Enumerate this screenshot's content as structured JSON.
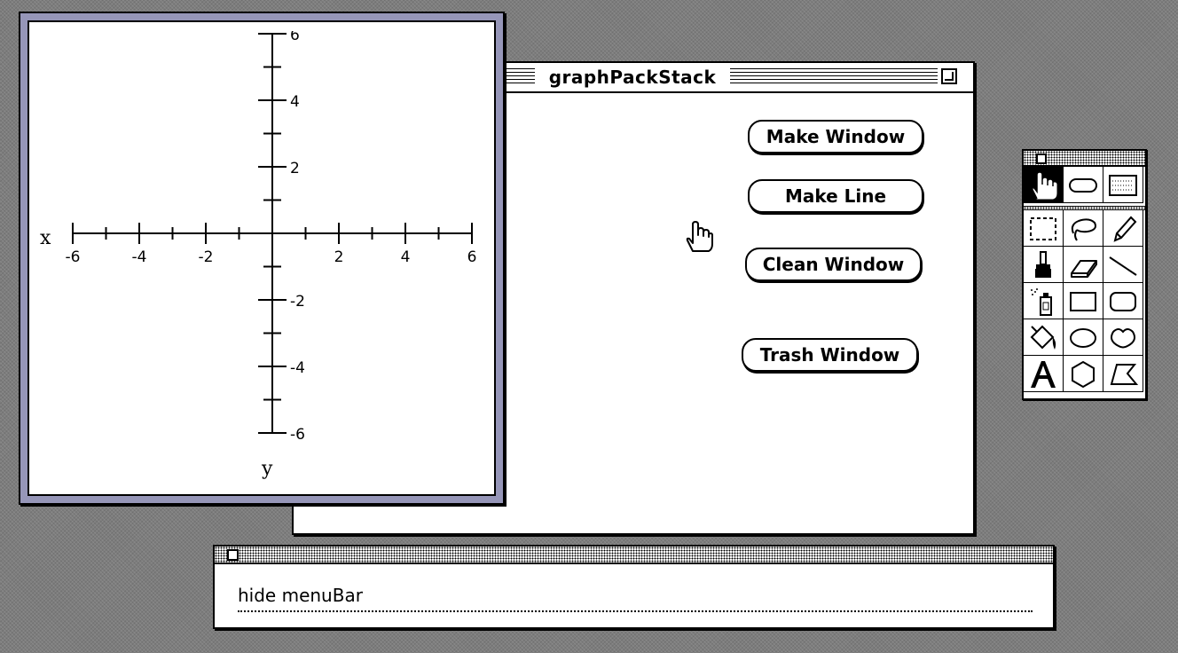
{
  "stack_window": {
    "title": "graphPackStack",
    "buttons": {
      "make_window": "Make Window",
      "make_line": "Make Line",
      "clean_window": "Clean Window",
      "trash_window": "Trash Window"
    }
  },
  "graph_window": {
    "x_axis_label": "x",
    "y_axis_label": "y",
    "x_tick_labels": [
      "-6",
      "-4",
      "-2",
      "2",
      "4",
      "6"
    ],
    "y_tick_labels": [
      "6",
      "4",
      "2",
      "-2",
      "-4",
      "-6"
    ],
    "x_range": [
      -6,
      6
    ],
    "y_range": [
      -6,
      6
    ],
    "colors": {
      "frame": "#9696b8"
    }
  },
  "tools_palette": {
    "icons": [
      "browse-hand-icon",
      "button-tool-icon",
      "field-tool-icon",
      "select-icon",
      "lasso-icon",
      "pencil-icon",
      "brush-icon",
      "eraser-icon",
      "line-icon",
      "spray-can-icon",
      "rectangle-icon",
      "round-rectangle-icon",
      "bucket-icon",
      "oval-icon",
      "curve-icon",
      "text-icon",
      "regular-polygon-icon",
      "polygon-icon"
    ],
    "selected": "browse-hand-icon"
  },
  "message_box": {
    "value": "hide menuBar"
  },
  "cursor": "hand-cursor-icon"
}
